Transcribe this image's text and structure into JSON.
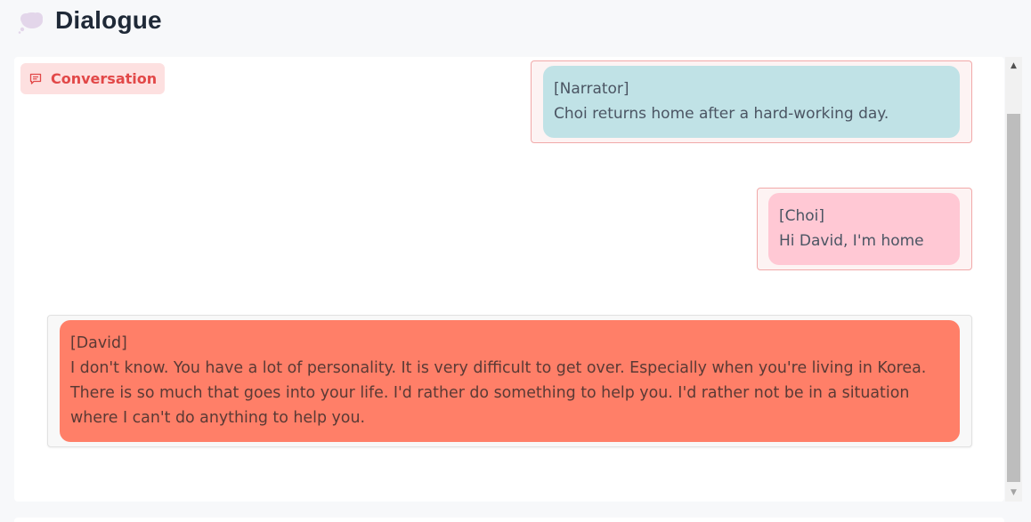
{
  "header": {
    "title": "Dialogue",
    "icon": "thought-bubble-icon"
  },
  "tag": {
    "label": "Conversation",
    "icon": "chat-icon",
    "color": "#e24848"
  },
  "messages": [
    {
      "speaker": "[Narrator]",
      "text": "Choi returns home after a hard-working day.",
      "color": "#c0e2e6"
    },
    {
      "speaker": "[Choi]",
      "text": "Hi David, I'm home",
      "color": "#ffc8d4"
    },
    {
      "speaker": "[David]",
      "text": "I don't know. You have a lot of personality. It is very difficult to get over. Especially when you're living in Korea. There is so much that goes into your life. I'd rather do something to help you. I'd rather not be in a situation where I can't do anything to help you.",
      "color": "#ff7f68"
    }
  ],
  "scrollbar": {
    "up_icon": "▲",
    "down_icon": "▼"
  }
}
